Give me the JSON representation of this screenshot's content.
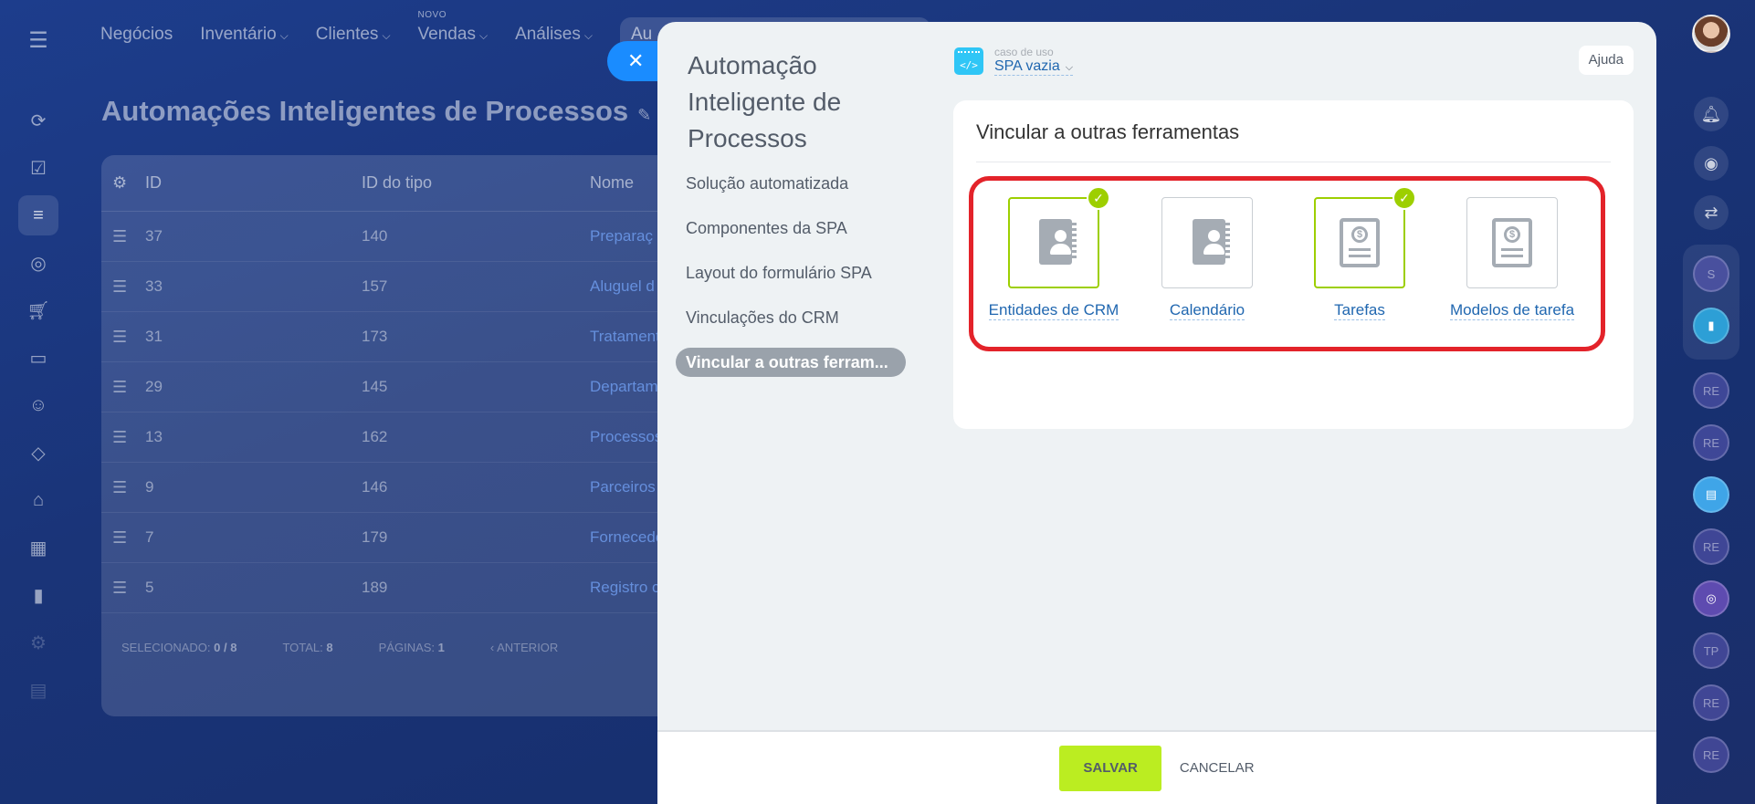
{
  "nav": {
    "items": [
      {
        "label": "Negócios",
        "chevron": false
      },
      {
        "label": "Inventário",
        "chevron": true
      },
      {
        "label": "Clientes",
        "chevron": true
      },
      {
        "label": "Vendas",
        "chevron": true,
        "badge": "NOVO"
      },
      {
        "label": "Análises",
        "chevron": true
      }
    ],
    "pill_text": "Au"
  },
  "background": {
    "title": "Automações Inteligentes de Processos",
    "table": {
      "columns": [
        "ID",
        "ID do tipo",
        "Nome"
      ],
      "rows": [
        {
          "id": "37",
          "type_id": "140",
          "name": "Preparaç"
        },
        {
          "id": "33",
          "type_id": "157",
          "name": "Aluguel d"
        },
        {
          "id": "31",
          "type_id": "173",
          "name": "Tratament"
        },
        {
          "id": "29",
          "type_id": "145",
          "name": "Departam"
        },
        {
          "id": "13",
          "type_id": "162",
          "name": "Processos"
        },
        {
          "id": "9",
          "type_id": "146",
          "name": "Parceiros"
        },
        {
          "id": "7",
          "type_id": "179",
          "name": "Fornecedo"
        },
        {
          "id": "5",
          "type_id": "189",
          "name": "Registro c"
        }
      ],
      "footer": {
        "selected_label": "SELECIONADO:",
        "selected_value": "0 / 8",
        "total_label": "TOTAL:",
        "total_value": "8",
        "pages_label": "PÁGINAS:",
        "pages_value": "1",
        "prev_label": "ANTERIOR"
      }
    }
  },
  "right_rail": {
    "avatars_top": [
      "S"
    ],
    "avatars": [
      "RE",
      "RE",
      "RE",
      "TP",
      "RE",
      "RE"
    ]
  },
  "panel": {
    "title": "Automação Inteligente de Processos",
    "menu": [
      {
        "label": "Solução automatizada",
        "active": false
      },
      {
        "label": "Componentes da SPA",
        "active": false
      },
      {
        "label": "Layout do formulário SPA",
        "active": false
      },
      {
        "label": "Vinculações do CRM",
        "active": false
      },
      {
        "label": "Vincular a outras ferram...",
        "active": true
      }
    ],
    "usecase_label": "caso de uso",
    "usecase_value": "SPA vazia",
    "help_label": "Ajuda",
    "section_title": "Vincular a outras ferramentas",
    "tools": [
      {
        "label": "Entidades de CRM",
        "icon": "contact-book-icon",
        "checked": true
      },
      {
        "label": "Calendário",
        "icon": "contact-book-icon",
        "checked": false
      },
      {
        "label": "Tarefas",
        "icon": "invoice-icon",
        "checked": true
      },
      {
        "label": "Modelos de tarefa",
        "icon": "invoice-icon",
        "checked": false
      }
    ],
    "save_label": "SALVAR",
    "cancel_label": "CANCELAR"
  },
  "colors": {
    "accent_green": "#bbed21",
    "check_green": "#9dcf00",
    "highlight_red": "#e3232a",
    "link_blue": "#2067b0",
    "close_blue": "#1a8cff"
  }
}
